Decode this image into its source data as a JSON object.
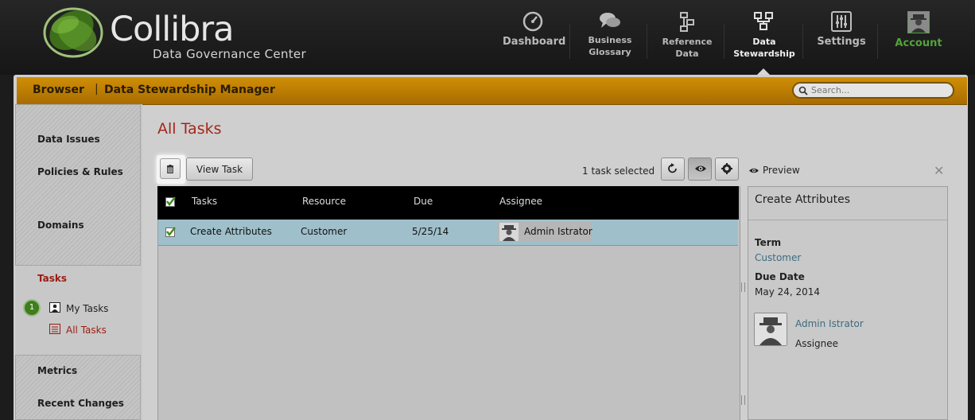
{
  "brand": {
    "name": "Collibra",
    "subtitle": "Data Governance Center"
  },
  "topnav": [
    {
      "label": "Dashboard",
      "icon": "dashboard-gauge-icon"
    },
    {
      "label": "Business\nGlossary",
      "icon": "chat-bubbles-icon"
    },
    {
      "label": "Reference\nData",
      "icon": "reference-data-icon"
    },
    {
      "label": "Data\nStewardship",
      "icon": "stewardship-icon",
      "active": true
    },
    {
      "label": "Settings",
      "icon": "sliders-icon"
    },
    {
      "label": "Account",
      "icon": "user-avatar-icon",
      "color": "#52a43a"
    }
  ],
  "breadcrumb": {
    "root": "Browser",
    "separator": "|",
    "current": "Data Stewardship Manager"
  },
  "search": {
    "placeholder": "Search..."
  },
  "sidebar": {
    "items": [
      "Data Issues",
      "Policies & Rules",
      "Domains"
    ],
    "tasks_label": "Tasks",
    "task_count": "1",
    "subitems": [
      "My Tasks",
      "All Tasks"
    ],
    "bottom_items": [
      "Metrics",
      "Recent Changes"
    ]
  },
  "content": {
    "title": "All Tasks",
    "view_button": "View Task",
    "selection_status": "1 task selected"
  },
  "table": {
    "columns": [
      "Tasks",
      "Resource",
      "Due",
      "Assignee"
    ],
    "rows": [
      {
        "task": "Create Attributes",
        "resource": "Customer",
        "due": "5/25/14",
        "assignee": "Admin Istrator",
        "checked": true
      }
    ]
  },
  "preview": {
    "label": "Preview",
    "title": "Create Attributes",
    "term_label": "Term",
    "term_value": "Customer",
    "due_label": "Due Date",
    "due_value": "May 24, 2014",
    "assignee_name": "Admin Istrator",
    "assignee_role": "Assignee"
  },
  "colors": {
    "accent": "#a3281a",
    "brand_bar": "#c0800a",
    "selected_row": "#9fc0cb",
    "account": "#52a43a"
  }
}
